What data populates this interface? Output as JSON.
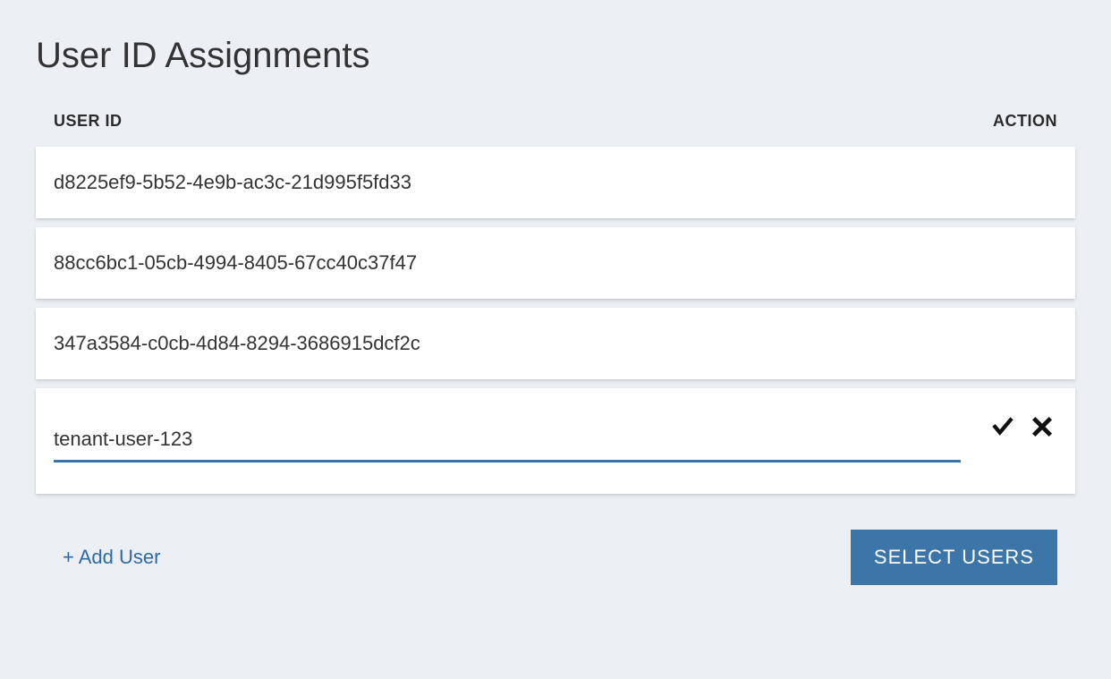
{
  "title": "User ID Assignments",
  "columns": {
    "user_id": "USER ID",
    "action": "ACTION"
  },
  "rows": [
    {
      "user_id": "d8225ef9-5b52-4e9b-ac3c-21d995f5fd33"
    },
    {
      "user_id": "88cc6bc1-05cb-4994-8405-67cc40c37f47"
    },
    {
      "user_id": "347a3584-c0cb-4d84-8294-3686915dcf2c"
    }
  ],
  "editing": {
    "value": "tenant-user-123"
  },
  "actions": {
    "add_user": "+ Add User",
    "select_users": "SELECT USERS"
  },
  "icons": {
    "confirm": "check-icon",
    "cancel": "close-icon"
  },
  "colors": {
    "accent": "#3c76a8",
    "link": "#2d6aa6",
    "bg": "#eceff3"
  }
}
